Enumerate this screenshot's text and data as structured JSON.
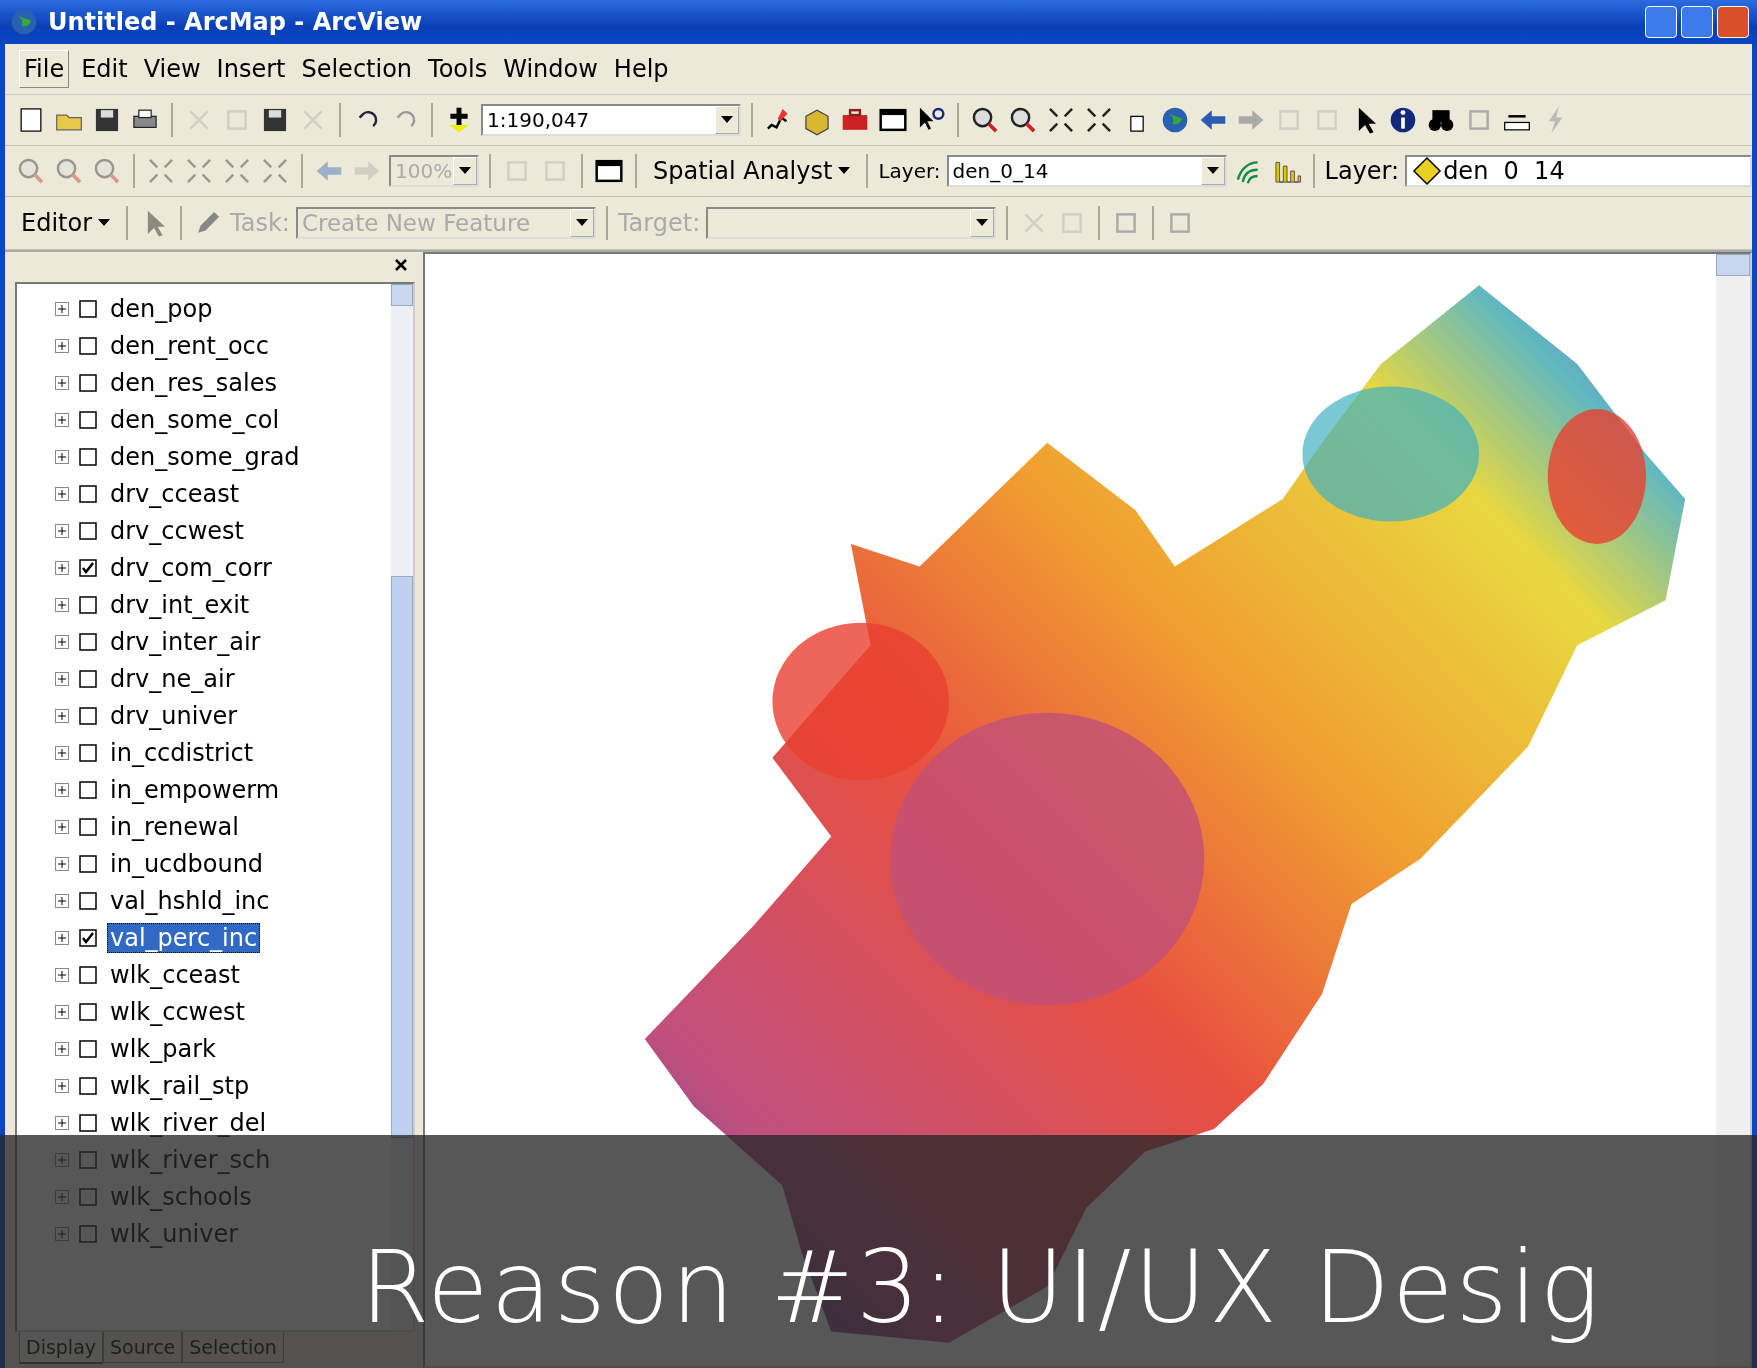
{
  "window": {
    "title": "Untitled - ArcMap - ArcView"
  },
  "menu": [
    {
      "label": "File",
      "selected": true
    },
    {
      "label": "Edit",
      "selected": false
    },
    {
      "label": "View",
      "selected": false
    },
    {
      "label": "Insert",
      "selected": false
    },
    {
      "label": "Selection",
      "selected": false
    },
    {
      "label": "Tools",
      "selected": false
    },
    {
      "label": "Window",
      "selected": false
    },
    {
      "label": "Help",
      "selected": false
    }
  ],
  "standard_toolbar": {
    "scale": "1:190,047"
  },
  "second_toolbar": {
    "zoom": "100%",
    "spatial_analyst": "Spatial Analyst",
    "layer_label": "Layer:",
    "layer_value": "den_0_14",
    "layer2_label": "Layer:",
    "layer2_value": "den  0  14"
  },
  "editor_toolbar": {
    "editor": "Editor",
    "task_label": "Task:",
    "task_value": "Create New Feature",
    "target_label": "Target:"
  },
  "layers": [
    {
      "name": "den_pop",
      "checked": false,
      "selected": false
    },
    {
      "name": "den_rent_occ",
      "checked": false,
      "selected": false
    },
    {
      "name": "den_res_sales",
      "checked": false,
      "selected": false
    },
    {
      "name": "den_some_col",
      "checked": false,
      "selected": false
    },
    {
      "name": "den_some_grad",
      "checked": false,
      "selected": false
    },
    {
      "name": "drv_cceast",
      "checked": false,
      "selected": false
    },
    {
      "name": "drv_ccwest",
      "checked": false,
      "selected": false
    },
    {
      "name": "drv_com_corr",
      "checked": true,
      "selected": false
    },
    {
      "name": "drv_int_exit",
      "checked": false,
      "selected": false
    },
    {
      "name": "drv_inter_air",
      "checked": false,
      "selected": false
    },
    {
      "name": "drv_ne_air",
      "checked": false,
      "selected": false
    },
    {
      "name": "drv_univer",
      "checked": false,
      "selected": false
    },
    {
      "name": "in_ccdistrict",
      "checked": false,
      "selected": false
    },
    {
      "name": "in_empowerm",
      "checked": false,
      "selected": false
    },
    {
      "name": "in_renewal",
      "checked": false,
      "selected": false
    },
    {
      "name": "in_ucdbound",
      "checked": false,
      "selected": false
    },
    {
      "name": "val_hshld_inc",
      "checked": false,
      "selected": false
    },
    {
      "name": "val_perc_inc",
      "checked": true,
      "selected": true
    },
    {
      "name": "wlk_cceast",
      "checked": false,
      "selected": false
    },
    {
      "name": "wlk_ccwest",
      "checked": false,
      "selected": false
    },
    {
      "name": "wlk_park",
      "checked": false,
      "selected": false
    },
    {
      "name": "wlk_rail_stp",
      "checked": false,
      "selected": false
    },
    {
      "name": "wlk_river_del",
      "checked": false,
      "selected": false
    },
    {
      "name": "wlk_river_sch",
      "checked": false,
      "selected": false
    },
    {
      "name": "wlk_schools",
      "checked": false,
      "selected": false
    },
    {
      "name": "wlk_univer",
      "checked": false,
      "selected": false
    }
  ],
  "toc_tabs": [
    {
      "label": "Display",
      "selected": true
    },
    {
      "label": "Source",
      "selected": false
    },
    {
      "label": "Selection",
      "selected": false
    }
  ],
  "caption": "Reason #3: UI/UX Desig"
}
